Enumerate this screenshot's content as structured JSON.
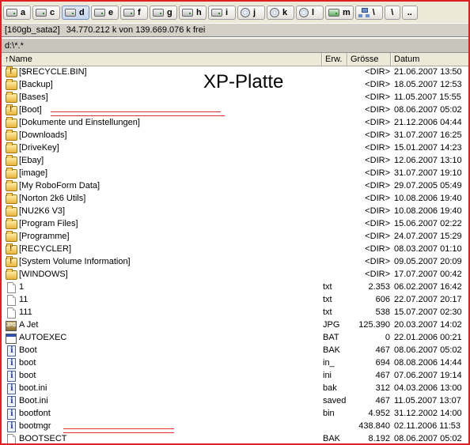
{
  "drives": [
    {
      "letter": "a",
      "icon": "floppy-drive-icon"
    },
    {
      "letter": "c",
      "icon": "hard-drive-icon"
    },
    {
      "letter": "d",
      "icon": "hard-drive-icon",
      "active": true
    },
    {
      "letter": "e",
      "icon": "hard-drive-icon"
    },
    {
      "letter": "f",
      "icon": "hard-drive-icon"
    },
    {
      "letter": "g",
      "icon": "hard-drive-icon"
    },
    {
      "letter": "h",
      "icon": "hard-drive-icon"
    },
    {
      "letter": "i",
      "icon": "hard-drive-icon"
    },
    {
      "letter": "j",
      "icon": "cd-drive-icon"
    },
    {
      "letter": "k",
      "icon": "cd-drive-icon"
    },
    {
      "letter": "l",
      "icon": "cd-drive-icon"
    },
    {
      "letter": "m",
      "icon": "network-drive-icon"
    },
    {
      "letter": "\\",
      "icon": "network-tree-icon"
    },
    {
      "letter": "\\",
      "icon": "root-icon"
    },
    {
      "letter": "..",
      "icon": "up-icon"
    }
  ],
  "drive_info": {
    "label": "[160gb_sata2]",
    "free": "34.770.212 k von 139.669.076 k frei"
  },
  "path": "d:\\*.*",
  "columns": {
    "name": "↑Name",
    "ext": "Erw.",
    "size": "Grösse",
    "date": "Datum"
  },
  "annotation": "XP-Platte",
  "files": [
    {
      "name": "[$RECYCLE.BIN]",
      "ext": "",
      "size": "<DIR>",
      "date": "21.06.2007 13:50",
      "type": "folder-sys"
    },
    {
      "name": "[Backup]",
      "ext": "",
      "size": "<DIR>",
      "date": "18.05.2007 12:53",
      "type": "folder"
    },
    {
      "name": "[Bases]",
      "ext": "",
      "size": "<DIR>",
      "date": "11.05.2007 15:55",
      "type": "folder"
    },
    {
      "name": "[Boot]",
      "ext": "",
      "size": "<DIR>",
      "date": "08.06.2007 05:02",
      "type": "folder-sys"
    },
    {
      "name": "[Dokumente und Einstellungen]",
      "ext": "",
      "size": "<DIR>",
      "date": "21.12.2006 04:44",
      "type": "folder"
    },
    {
      "name": "[Downloads]",
      "ext": "",
      "size": "<DIR>",
      "date": "31.07.2007 16:25",
      "type": "folder"
    },
    {
      "name": "[DriveKey]",
      "ext": "",
      "size": "<DIR>",
      "date": "15.01.2007 14:23",
      "type": "folder"
    },
    {
      "name": "[Ebay]",
      "ext": "",
      "size": "<DIR>",
      "date": "12.06.2007 13:10",
      "type": "folder"
    },
    {
      "name": "[image]",
      "ext": "",
      "size": "<DIR>",
      "date": "31.07.2007 19:10",
      "type": "folder"
    },
    {
      "name": "[My RoboForm Data]",
      "ext": "",
      "size": "<DIR>",
      "date": "29.07.2005 05:49",
      "type": "folder"
    },
    {
      "name": "[Norton 2k6 Utils]",
      "ext": "",
      "size": "<DIR>",
      "date": "10.08.2006 19:40",
      "type": "folder"
    },
    {
      "name": "[NU2K6 V3]",
      "ext": "",
      "size": "<DIR>",
      "date": "10.08.2006 19:40",
      "type": "folder"
    },
    {
      "name": "[Program Files]",
      "ext": "",
      "size": "<DIR>",
      "date": "15.06.2007 02:22",
      "type": "folder"
    },
    {
      "name": "[Programme]",
      "ext": "",
      "size": "<DIR>",
      "date": "24.07.2007 15:29",
      "type": "folder"
    },
    {
      "name": "[RECYCLER]",
      "ext": "",
      "size": "<DIR>",
      "date": "08.03.2007 01:10",
      "type": "folder-sys"
    },
    {
      "name": "[System Volume Information]",
      "ext": "",
      "size": "<DIR>",
      "date": "09.05.2007 20:09",
      "type": "folder-sys"
    },
    {
      "name": "[WINDOWS]",
      "ext": "",
      "size": "<DIR>",
      "date": "17.07.2007 00:42",
      "type": "folder"
    },
    {
      "name": "1",
      "ext": "txt",
      "size": "2.353",
      "date": "06.02.2007 16:42",
      "type": "file"
    },
    {
      "name": "11",
      "ext": "txt",
      "size": "606",
      "date": "22.07.2007 20:17",
      "type": "file"
    },
    {
      "name": "111",
      "ext": "txt",
      "size": "538",
      "date": "15.07.2007 02:30",
      "type": "file"
    },
    {
      "name": "A Jet",
      "ext": "JPG",
      "size": "125.390",
      "date": "20.03.2007 14:02",
      "type": "jpg"
    },
    {
      "name": "AUTOEXEC",
      "ext": "BAT",
      "size": "0",
      "date": "22.01.2006 00:21",
      "type": "bat"
    },
    {
      "name": "Boot",
      "ext": "BAK",
      "size": "467",
      "date": "08.06.2007 05:02",
      "type": "file-info"
    },
    {
      "name": "boot",
      "ext": "in_",
      "size": "694",
      "date": "08.08.2006 14:44",
      "type": "file-info"
    },
    {
      "name": "boot",
      "ext": "ini",
      "size": "467",
      "date": "07.06.2007 19:14",
      "type": "file-info"
    },
    {
      "name": "boot.ini",
      "ext": "bak",
      "size": "312",
      "date": "04.03.2006 13:00",
      "type": "file-info"
    },
    {
      "name": "Boot.ini",
      "ext": "saved",
      "size": "467",
      "date": "11.05.2007 13:07",
      "type": "file-info"
    },
    {
      "name": "bootfont",
      "ext": "bin",
      "size": "4.952",
      "date": "31.12.2002 14:00",
      "type": "file-info"
    },
    {
      "name": "bootmgr",
      "ext": "",
      "size": "438.840",
      "date": "02.11.2006 11:53",
      "type": "file-info"
    },
    {
      "name": "BOOTSECT",
      "ext": "BAK",
      "size": "8.192",
      "date": "08.06.2007 05:02",
      "type": "file"
    }
  ]
}
